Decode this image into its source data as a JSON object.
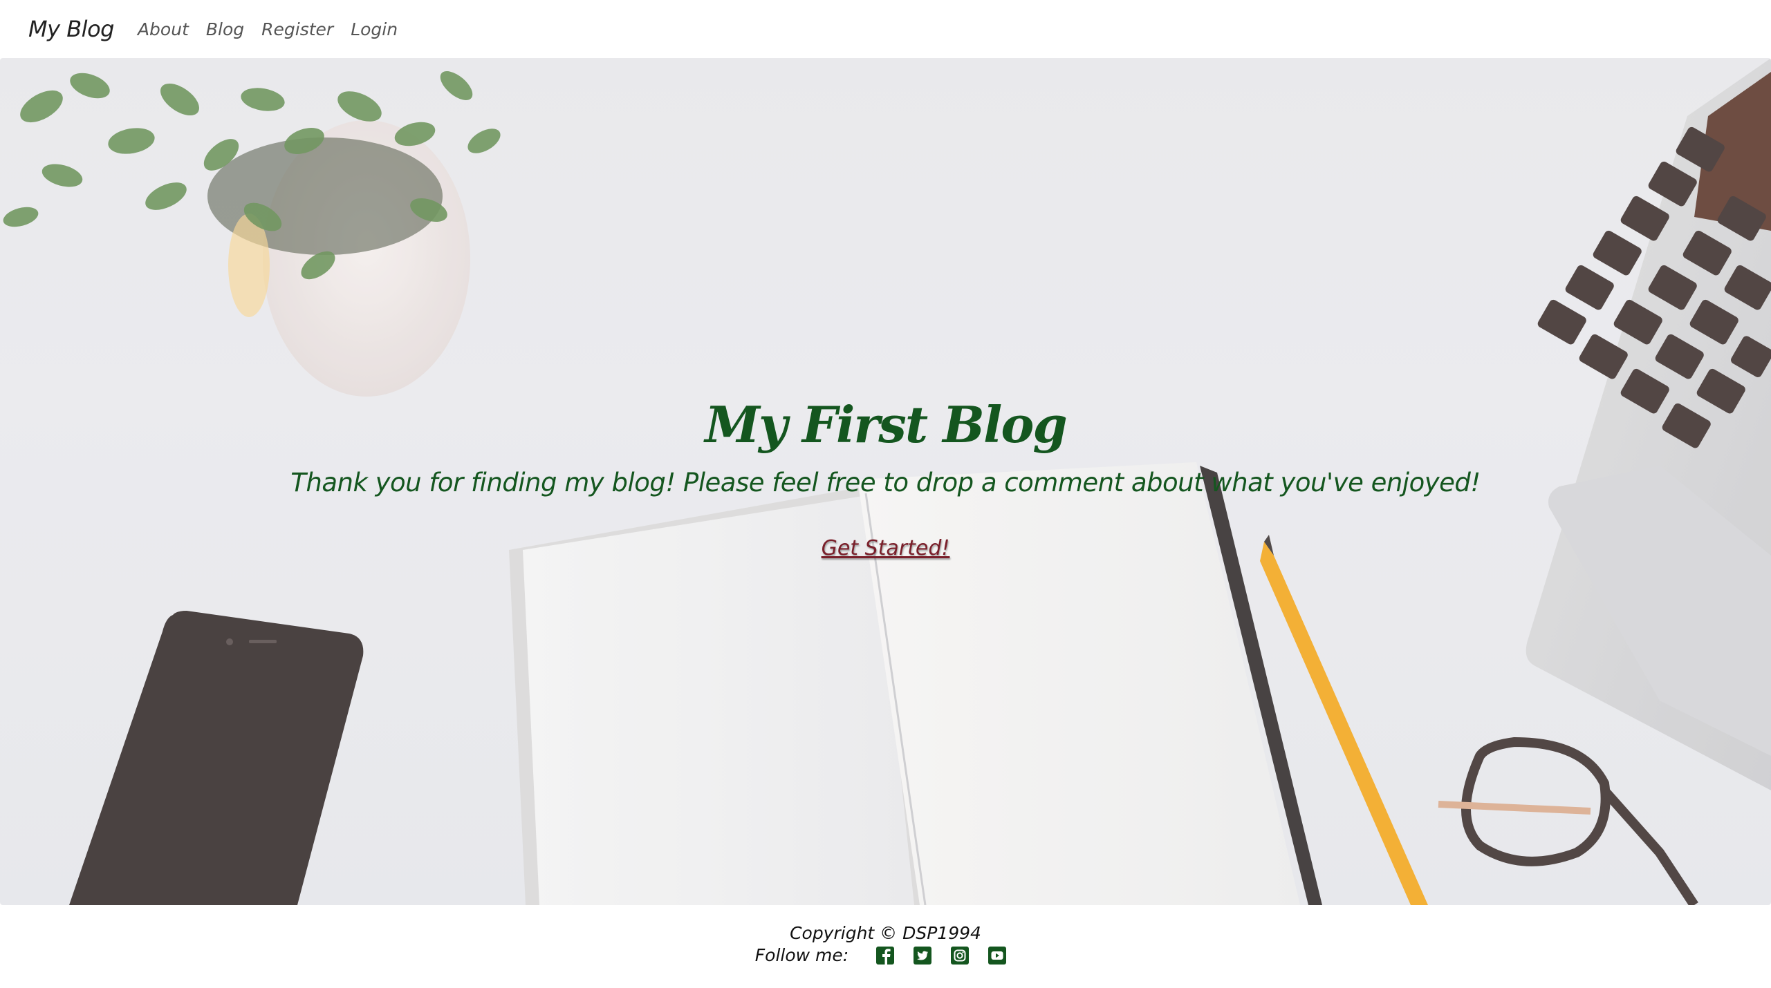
{
  "navbar": {
    "brand": "My Blog",
    "links": [
      "About",
      "Blog",
      "Register",
      "Login"
    ]
  },
  "hero": {
    "title": "My First Blog",
    "subtitle": "Thank you for finding my blog! Please feel free to drop a comment about what you've enjoyed!",
    "cta": "Get Started!"
  },
  "footer": {
    "copyright": "Copyright © DSP1994",
    "follow_label": "Follow me:",
    "social_icons": [
      "facebook-icon",
      "twitter-icon",
      "instagram-icon",
      "youtube-icon"
    ]
  },
  "colors": {
    "accent_green": "#14561f",
    "cta_maroon": "#7a1f2a"
  }
}
